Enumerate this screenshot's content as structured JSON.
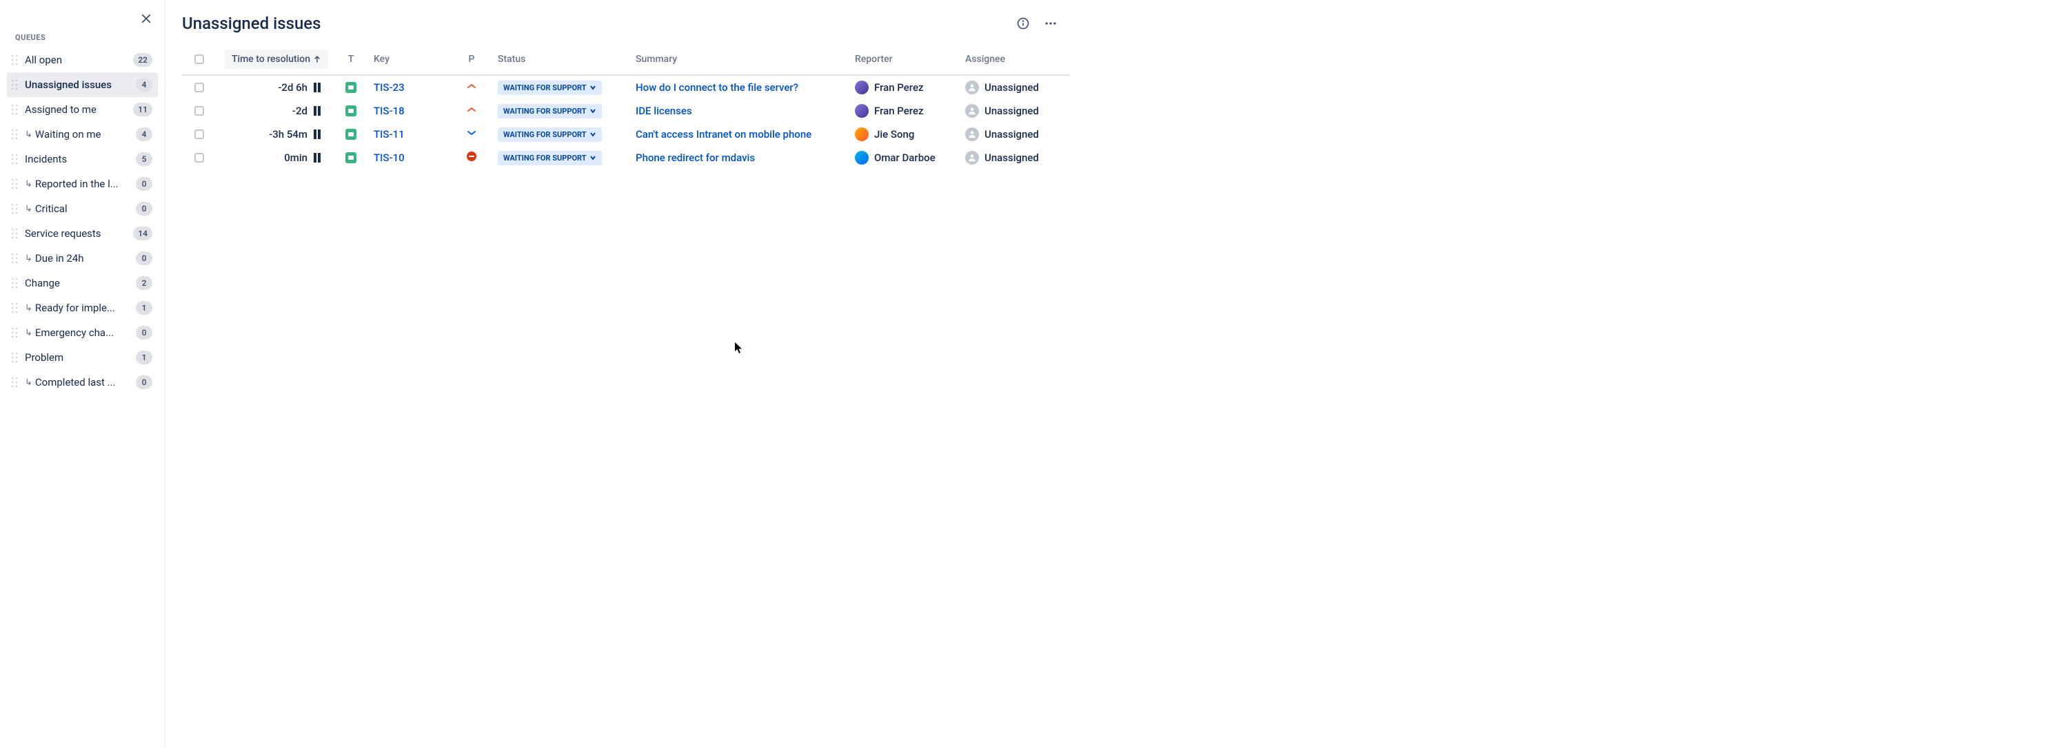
{
  "sidebar": {
    "section_label": "QUEUES",
    "items": [
      {
        "label": "All open",
        "count": "22",
        "child": false
      },
      {
        "label": "Unassigned issues",
        "count": "4",
        "child": false,
        "active": true
      },
      {
        "label": "Assigned to me",
        "count": "11",
        "child": false
      },
      {
        "label": "Waiting on me",
        "count": "4",
        "child": true
      },
      {
        "label": "Incidents",
        "count": "5",
        "child": false
      },
      {
        "label": "Reported in the l...",
        "count": "0",
        "child": true
      },
      {
        "label": "Critical",
        "count": "0",
        "child": true
      },
      {
        "label": "Service requests",
        "count": "14",
        "child": false
      },
      {
        "label": "Due in 24h",
        "count": "0",
        "child": true
      },
      {
        "label": "Change",
        "count": "2",
        "child": false
      },
      {
        "label": "Ready for imple...",
        "count": "1",
        "child": true
      },
      {
        "label": "Emergency cha...",
        "count": "0",
        "child": true
      },
      {
        "label": "Problem",
        "count": "1",
        "child": false
      },
      {
        "label": "Completed last ...",
        "count": "0",
        "child": true
      }
    ]
  },
  "page_title": "Unassigned issues",
  "columns": {
    "time": "Time to resolution",
    "t": "T",
    "key": "Key",
    "p": "P",
    "status": "Status",
    "summary": "Summary",
    "reporter": "Reporter",
    "assignee": "Assignee"
  },
  "rows": [
    {
      "time": "-2d 6h",
      "key": "TIS-23",
      "priority": "high",
      "status": "WAITING FOR SUPPORT",
      "summary": "How do I connect to the file server?",
      "reporter": "Fran Perez",
      "reporter_avatar": "a1",
      "assignee": "Unassigned"
    },
    {
      "time": "-2d",
      "key": "TIS-18",
      "priority": "high",
      "status": "WAITING FOR SUPPORT",
      "summary": "IDE licenses",
      "reporter": "Fran Perez",
      "reporter_avatar": "a1",
      "assignee": "Unassigned"
    },
    {
      "time": "-3h 54m",
      "key": "TIS-11",
      "priority": "low",
      "status": "WAITING FOR SUPPORT",
      "summary": "Can't access Intranet on mobile phone",
      "reporter": "Jie Song",
      "reporter_avatar": "a2",
      "assignee": "Unassigned"
    },
    {
      "time": "0min",
      "key": "TIS-10",
      "priority": "blocker",
      "status": "WAITING FOR SUPPORT",
      "summary": "Phone redirect for mdavis",
      "reporter": "Omar Darboe",
      "reporter_avatar": "a3",
      "assignee": "Unassigned"
    }
  ]
}
